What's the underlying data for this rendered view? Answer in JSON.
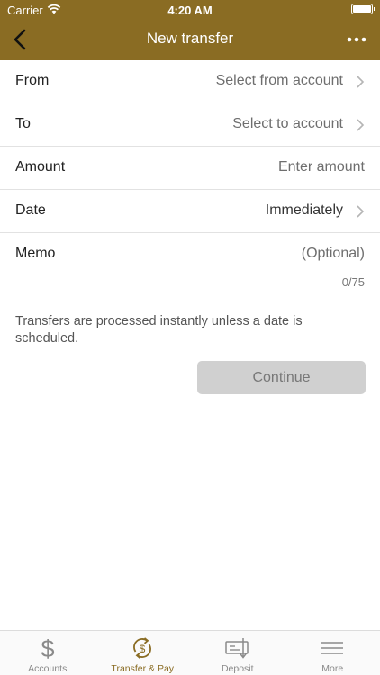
{
  "status": {
    "carrier": "Carrier",
    "time": "4:20 AM"
  },
  "nav": {
    "title": "New transfer"
  },
  "form": {
    "from": {
      "label": "From",
      "value": "Select from account"
    },
    "to": {
      "label": "To",
      "value": "Select to account"
    },
    "amount": {
      "label": "Amount",
      "placeholder": "Enter amount"
    },
    "date": {
      "label": "Date",
      "value": "Immediately"
    },
    "memo": {
      "label": "Memo",
      "placeholder": "(Optional)",
      "counter": "0/75"
    }
  },
  "note": "Transfers are processed instantly unless a date is scheduled.",
  "continue_label": "Continue",
  "tabs": [
    {
      "label": "Accounts",
      "icon": "dollar-icon",
      "active": false
    },
    {
      "label": "Transfer & Pay",
      "icon": "transfer-pay-icon",
      "active": true
    },
    {
      "label": "Deposit",
      "icon": "deposit-check-icon",
      "active": false
    },
    {
      "label": "More",
      "icon": "menu-icon",
      "active": false
    }
  ],
  "colors": {
    "brand": "#8a6c23",
    "button_disabled": "#d0d0d0",
    "tab_inactive": "#8a8a8a"
  }
}
